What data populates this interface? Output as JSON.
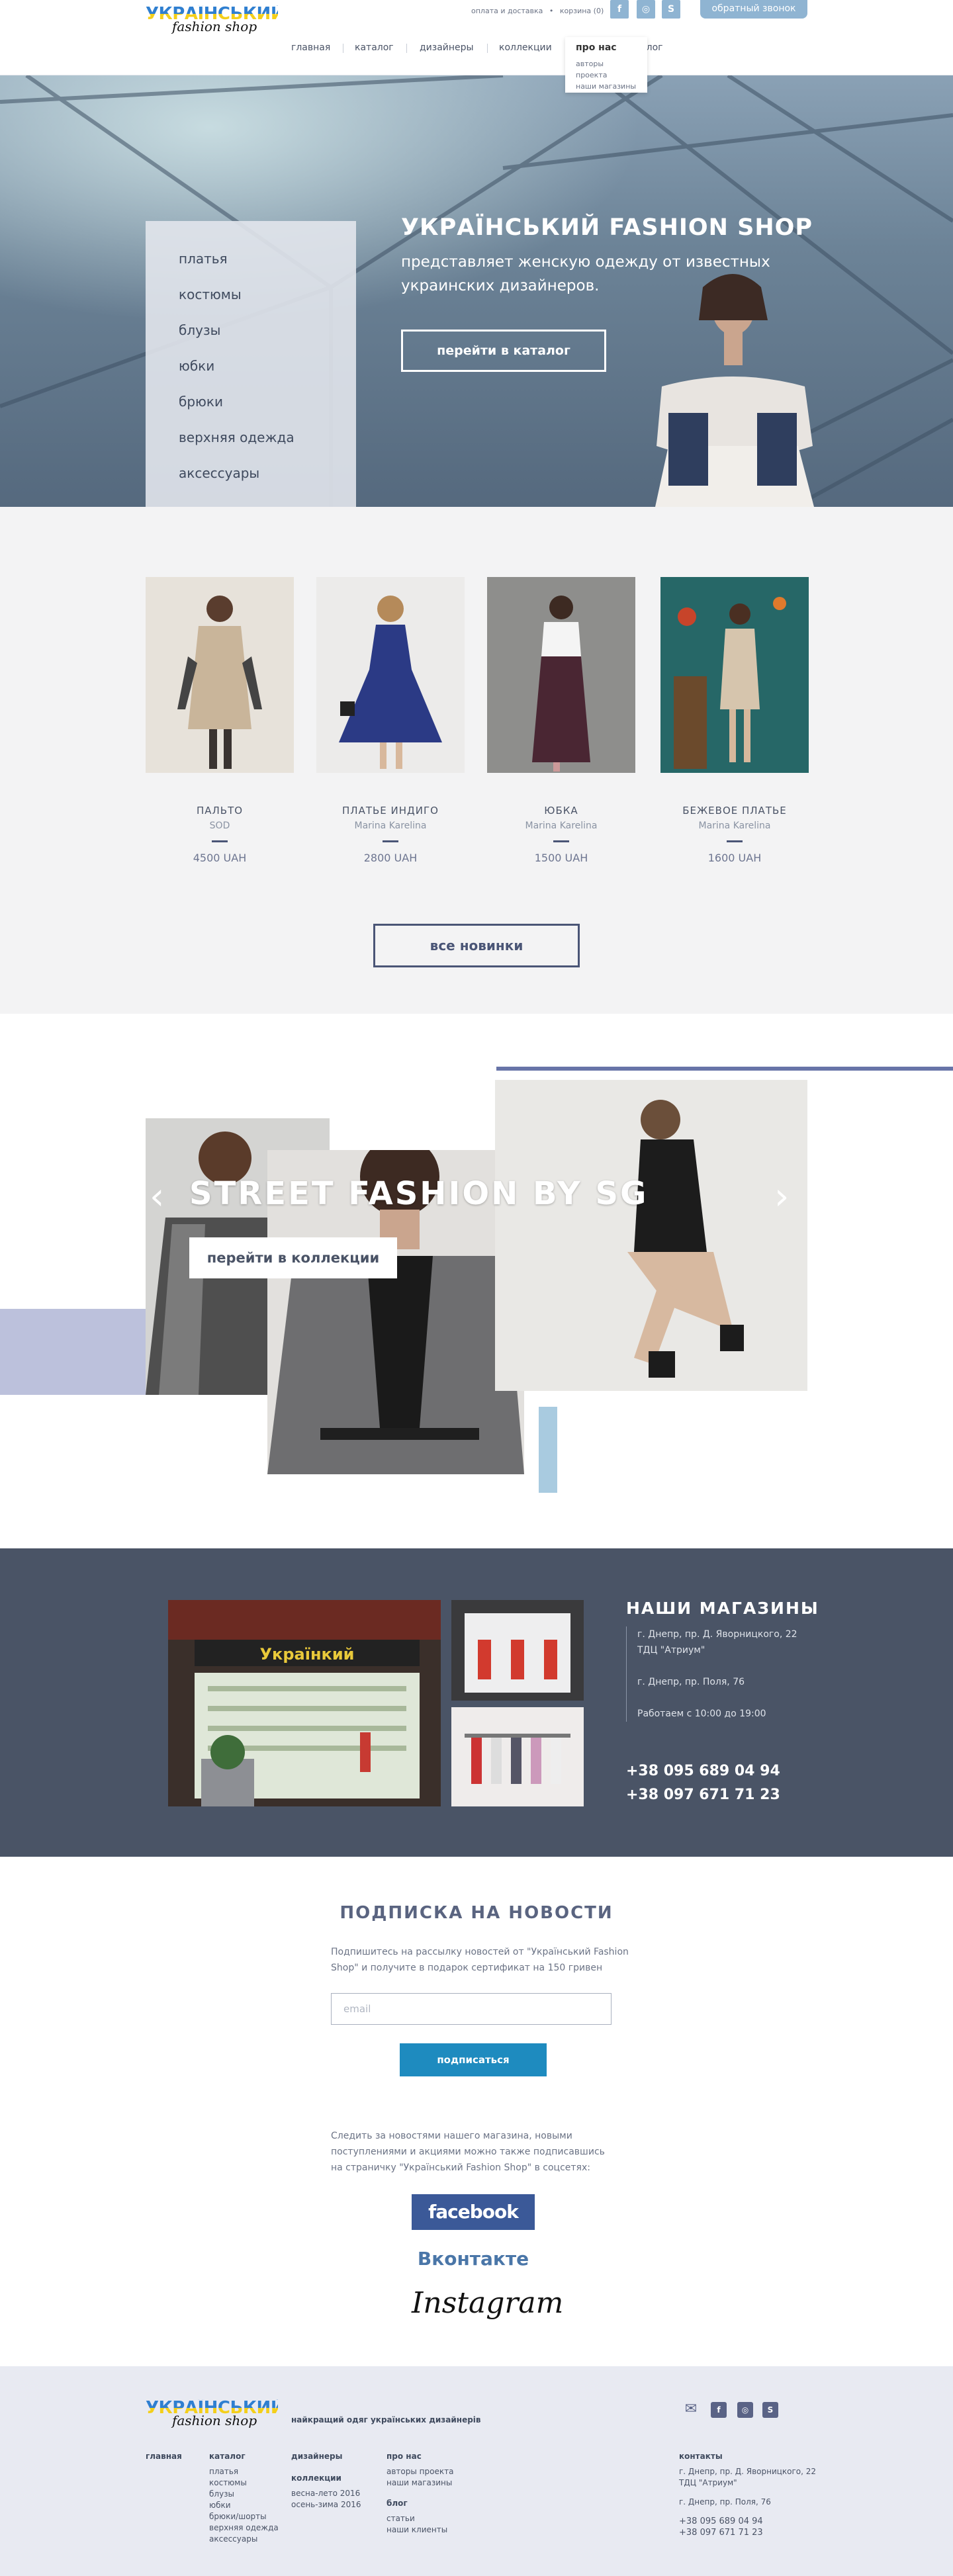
{
  "header": {
    "logo_line1": "УКРАЇНСЬКИЙ",
    "logo_line2": "fashion shop",
    "top_links": [
      "оплата и доставка",
      "•",
      "корзина (0)"
    ],
    "social": [
      "f",
      "◎",
      "S"
    ],
    "callback": "обратный звонок",
    "nav": [
      "главная",
      "каталог",
      "дизайнеры",
      "коллекции",
      "про нас",
      "блог"
    ],
    "dropdown": {
      "title": "про нас",
      "items": [
        "авторы проекта",
        "наши магазины"
      ]
    }
  },
  "hero": {
    "menu": [
      "платья",
      "костюмы",
      "блузы",
      "юбки",
      "брюки",
      "верхняя одежда",
      "аксессуары"
    ],
    "title": "УКРАЇНСЬКИЙ FASHION SHOP",
    "subtitle": "представляет женскую одежду от известных украинских дизайнеров.",
    "button": "перейти в каталог"
  },
  "products": {
    "items": [
      {
        "name": "ПАЛЬТО",
        "brand": "SOD",
        "price": "4500 UAH",
        "bg": "#c9b59a"
      },
      {
        "name": "ПЛАТЬЕ ИНДИГО",
        "brand": "Marina Karelina",
        "price": "2800 UAH",
        "bg": "#2b3a85"
      },
      {
        "name": "ЮБКА",
        "brand": "Marina Karelina",
        "price": "1500 UAH",
        "bg": "#5a2f3a"
      },
      {
        "name": "БЕЖЕВОЕ ПЛАТЬЕ",
        "brand": "Marina Karelina",
        "price": "1600 UAH",
        "bg": "#d6c5ad"
      }
    ],
    "all_button": "все новинки"
  },
  "street": {
    "title": "STREET FASHION BY SG",
    "button": "перейти в коллекции",
    "prev": "‹",
    "next": "›"
  },
  "stores": {
    "title": "НАШИ МАГАЗИНЫ",
    "addresses": [
      "г. Днепр, пр. Д. Яворницкого, 22",
      "ТДЦ \"Атриум\"",
      "г. Днепр, пр. Поля, 76",
      "Работаем с 10:00 до 19:00"
    ],
    "phones": [
      "+38 095 689 04 94",
      "+38 097 671 71 23"
    ],
    "sign": "Українкий"
  },
  "subscribe": {
    "title": "ПОДПИСКА НА НОВОСТИ",
    "text": "Подпишитесь на рассылку новостей от \"Український Fashion Shop\" и получите в подарок сертификат на 150 гривен",
    "email_placeholder": "email",
    "button": "подписаться",
    "text2": "Следить за новостями нашего магазина, новыми поступлениями и акциями можно также подписавшись на страничку \"Український Fashion Shop\" в соцсетях:",
    "facebook": "facebook",
    "vk": "Вконтакте",
    "instagram": "Instagram"
  },
  "footer": {
    "logo_line1": "УКРАЇНСЬКИЙ",
    "logo_line2": "fashion shop",
    "tagline": "найкращий одяг українських дизайнерів",
    "col_home": "главная",
    "catalog": {
      "title": "каталог",
      "items": [
        "платья",
        "костюмы",
        "блузы",
        "юбки",
        "брюки/шорты",
        "верхняя одежда",
        "аксессуары"
      ]
    },
    "designers": {
      "title": "дизайнеры"
    },
    "collections": {
      "title": "коллекции",
      "items": [
        "весна-лето 2016",
        "осень-зима 2016"
      ]
    },
    "about": {
      "title": "про нас",
      "items": [
        "авторы проекта",
        "наши магазины"
      ]
    },
    "blog": {
      "title": "блог",
      "items": [
        "статьи",
        "наши клиенты"
      ]
    },
    "contacts": {
      "title": "контакты",
      "items": [
        "г. Днепр, пр. Д. Яворницкого, 22",
        "ТДЦ \"Атриум\"",
        "г. Днепр, пр. Поля, 76"
      ],
      "phones": [
        "+38 095 689 04 94",
        "+38 097 671 71 23"
      ]
    },
    "icons": [
      "✉",
      "f",
      "◎",
      "S"
    ]
  }
}
